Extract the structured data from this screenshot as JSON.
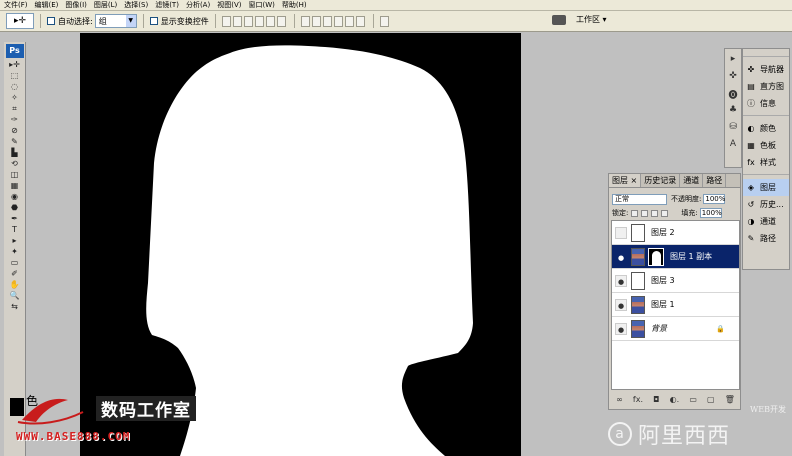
{
  "menu": [
    "文件(F)",
    "编辑(E)",
    "图像(I)",
    "图层(L)",
    "选择(S)",
    "滤镜(T)",
    "分析(A)",
    "视图(V)",
    "窗口(W)",
    "帮助(H)"
  ],
  "options": {
    "tool_icon": "move-tool-icon",
    "auto_select_label": "自动选择:",
    "auto_select_value": "组",
    "show_transform_label": "显示变换控件",
    "workspace_label": "工作区 ▾"
  },
  "toolbox": {
    "logo": "Ps",
    "tools": [
      "▸✛",
      "⬚",
      "◌",
      "✧",
      "⌗",
      "✑",
      "⊘",
      "✎",
      "▙",
      "⟲",
      "◫",
      "▦",
      "◉",
      "⬣",
      "✒",
      "T",
      "▸",
      "✦",
      "▭",
      "✐",
      "✋",
      "🔍",
      "⇆"
    ]
  },
  "dock": {
    "icons": [
      "▸",
      "✜",
      "⓿",
      "♣",
      "⛁",
      "A"
    ],
    "items": [
      {
        "icon": "✜",
        "label": "导航器"
      },
      {
        "icon": "▤",
        "label": "直方图"
      },
      {
        "icon": "ⓘ",
        "label": "信息"
      },
      {
        "icon": "◐",
        "label": "颜色"
      },
      {
        "icon": "▦",
        "label": "色板"
      },
      {
        "icon": "fx",
        "label": "样式"
      },
      {
        "icon": "◈",
        "label": "图层"
      },
      {
        "icon": "↺",
        "label": "历史..."
      },
      {
        "icon": "◑",
        "label": "通道"
      },
      {
        "icon": "✎",
        "label": "路径"
      }
    ]
  },
  "layers_panel": {
    "tabs": [
      "图层 ×",
      "历史记录",
      "通道",
      "路径"
    ],
    "blend_mode": "正常",
    "opacity_label": "不透明度:",
    "opacity_value": "100%",
    "lock_label": "锁定:",
    "fill_label": "填充:",
    "fill_value": "100%",
    "layers": [
      {
        "name": "图层 2",
        "visible": false,
        "thumb": "white",
        "selected": false
      },
      {
        "name": "图层 1 副本",
        "visible": true,
        "thumb": "photo",
        "mask": true,
        "selected": true
      },
      {
        "name": "图层 3",
        "visible": true,
        "thumb": "white",
        "selected": false
      },
      {
        "name": "图层 1",
        "visible": true,
        "thumb": "photo",
        "selected": false
      },
      {
        "name": "背景",
        "visible": true,
        "thumb": "photo",
        "selected": false,
        "locked": true
      }
    ],
    "footer_icons": [
      "∞",
      "fx.",
      "◘",
      "◐.",
      "▭",
      "▢",
      "🗑"
    ]
  },
  "watermarks": {
    "se": "色",
    "studio": "数码工作室",
    "url": "WWW.BASE888.COM",
    "web": "WEB开发",
    "brand": "阿里西西"
  }
}
